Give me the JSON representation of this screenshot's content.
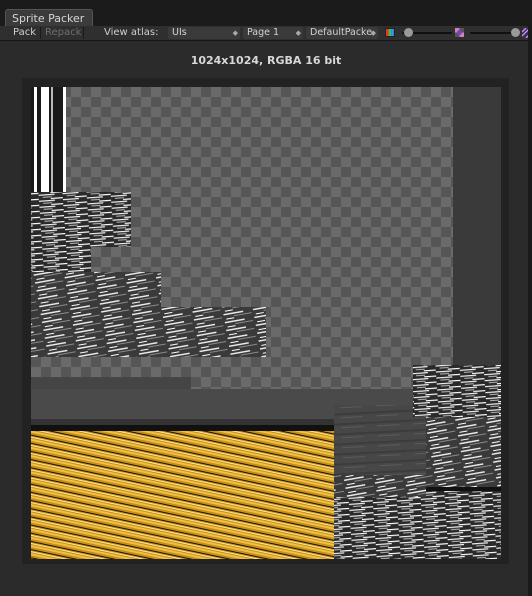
{
  "window": {
    "tab_title": "Sprite Packer"
  },
  "toolbar": {
    "pack_label": "Pack",
    "repack_label": "Repack",
    "view_atlas_label": "View atlas:",
    "atlas_select": "UIs",
    "page_select": "Page 1",
    "policy_select": "DefaultPacke",
    "icons": [
      "rgb-channels-icon",
      "alpha-channel-icon",
      "mip-stripes-icon"
    ]
  },
  "atlas_info": "1024x1024, RGBA 16 bit",
  "colors": {
    "sprite_gold": "#e2a623",
    "checker_light": "#6a6a6a",
    "checker_dark": "#565656"
  }
}
